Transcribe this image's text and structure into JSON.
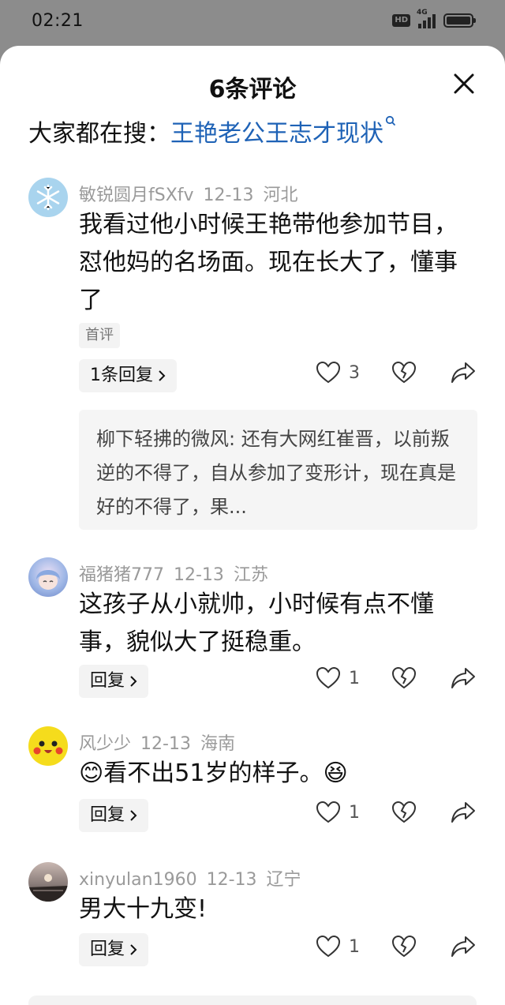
{
  "status_bar": {
    "time": "02:21",
    "hd": "HD",
    "network": "4G"
  },
  "sheet": {
    "title": "6条评论",
    "search_prefix": "大家都在搜：",
    "search_query": "王艳老公王志才现状"
  },
  "comments": [
    {
      "user": "敏锐圆月fSXfv",
      "date": "12-13",
      "region": "河北",
      "text": "我看过他小时候王艳带他参加节目，怼他妈的名场面。现在长大了，懂事了",
      "tag": "首评",
      "reply_label": "1条回复",
      "likes": "3",
      "reply_preview": "柳下轻拂的微风: 还有大网红崔晋，以前叛逆的不得了，自从参加了变形计，现在真是好的不得了，果..."
    },
    {
      "user": "福猪猪777",
      "date": "12-13",
      "region": "江苏",
      "text": "这孩子从小就帅，小时候有点不懂事，貌似大了挺稳重。",
      "reply_label": "回复",
      "likes": "1"
    },
    {
      "user": "风少少",
      "date": "12-13",
      "region": "海南",
      "text": "😊看不出51岁的样子。😆",
      "reply_label": "回复",
      "likes": "1"
    },
    {
      "user": "xinyulan1960",
      "date": "12-13",
      "region": "辽宁",
      "text": "男大十九变!",
      "reply_label": "回复",
      "likes": "1"
    }
  ]
}
